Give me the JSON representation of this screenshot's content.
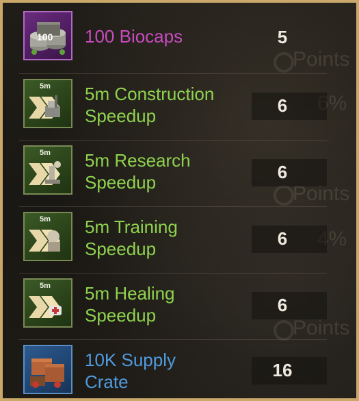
{
  "items": [
    {
      "name": "100 Biocaps",
      "name_line2": "",
      "qty": "5",
      "badge": "100",
      "icon": "biocaps-icon",
      "rarity_color": "#c94bbf"
    },
    {
      "name": "5m Construction",
      "name_line2": "Speedup",
      "qty": "6",
      "badge": "5m",
      "icon": "construction-speedup-icon",
      "rarity_color": "#8ed34e"
    },
    {
      "name": "5m Research",
      "name_line2": "Speedup",
      "qty": "6",
      "badge": "5m",
      "icon": "research-speedup-icon",
      "rarity_color": "#8ed34e"
    },
    {
      "name": "5m Training",
      "name_line2": "Speedup",
      "qty": "6",
      "badge": "5m",
      "icon": "training-speedup-icon",
      "rarity_color": "#8ed34e"
    },
    {
      "name": "5m Healing",
      "name_line2": "Speedup",
      "qty": "6",
      "badge": "5m",
      "icon": "healing-speedup-icon",
      "rarity_color": "#8ed34e"
    },
    {
      "name": "10K Supply",
      "name_line2": "Crate",
      "qty": "16",
      "badge": "",
      "icon": "supply-crate-icon",
      "rarity_color": "#4f9be0"
    }
  ],
  "background": {
    "points_label": "Points",
    "percent_1": "6%",
    "percent_2": "4%"
  }
}
